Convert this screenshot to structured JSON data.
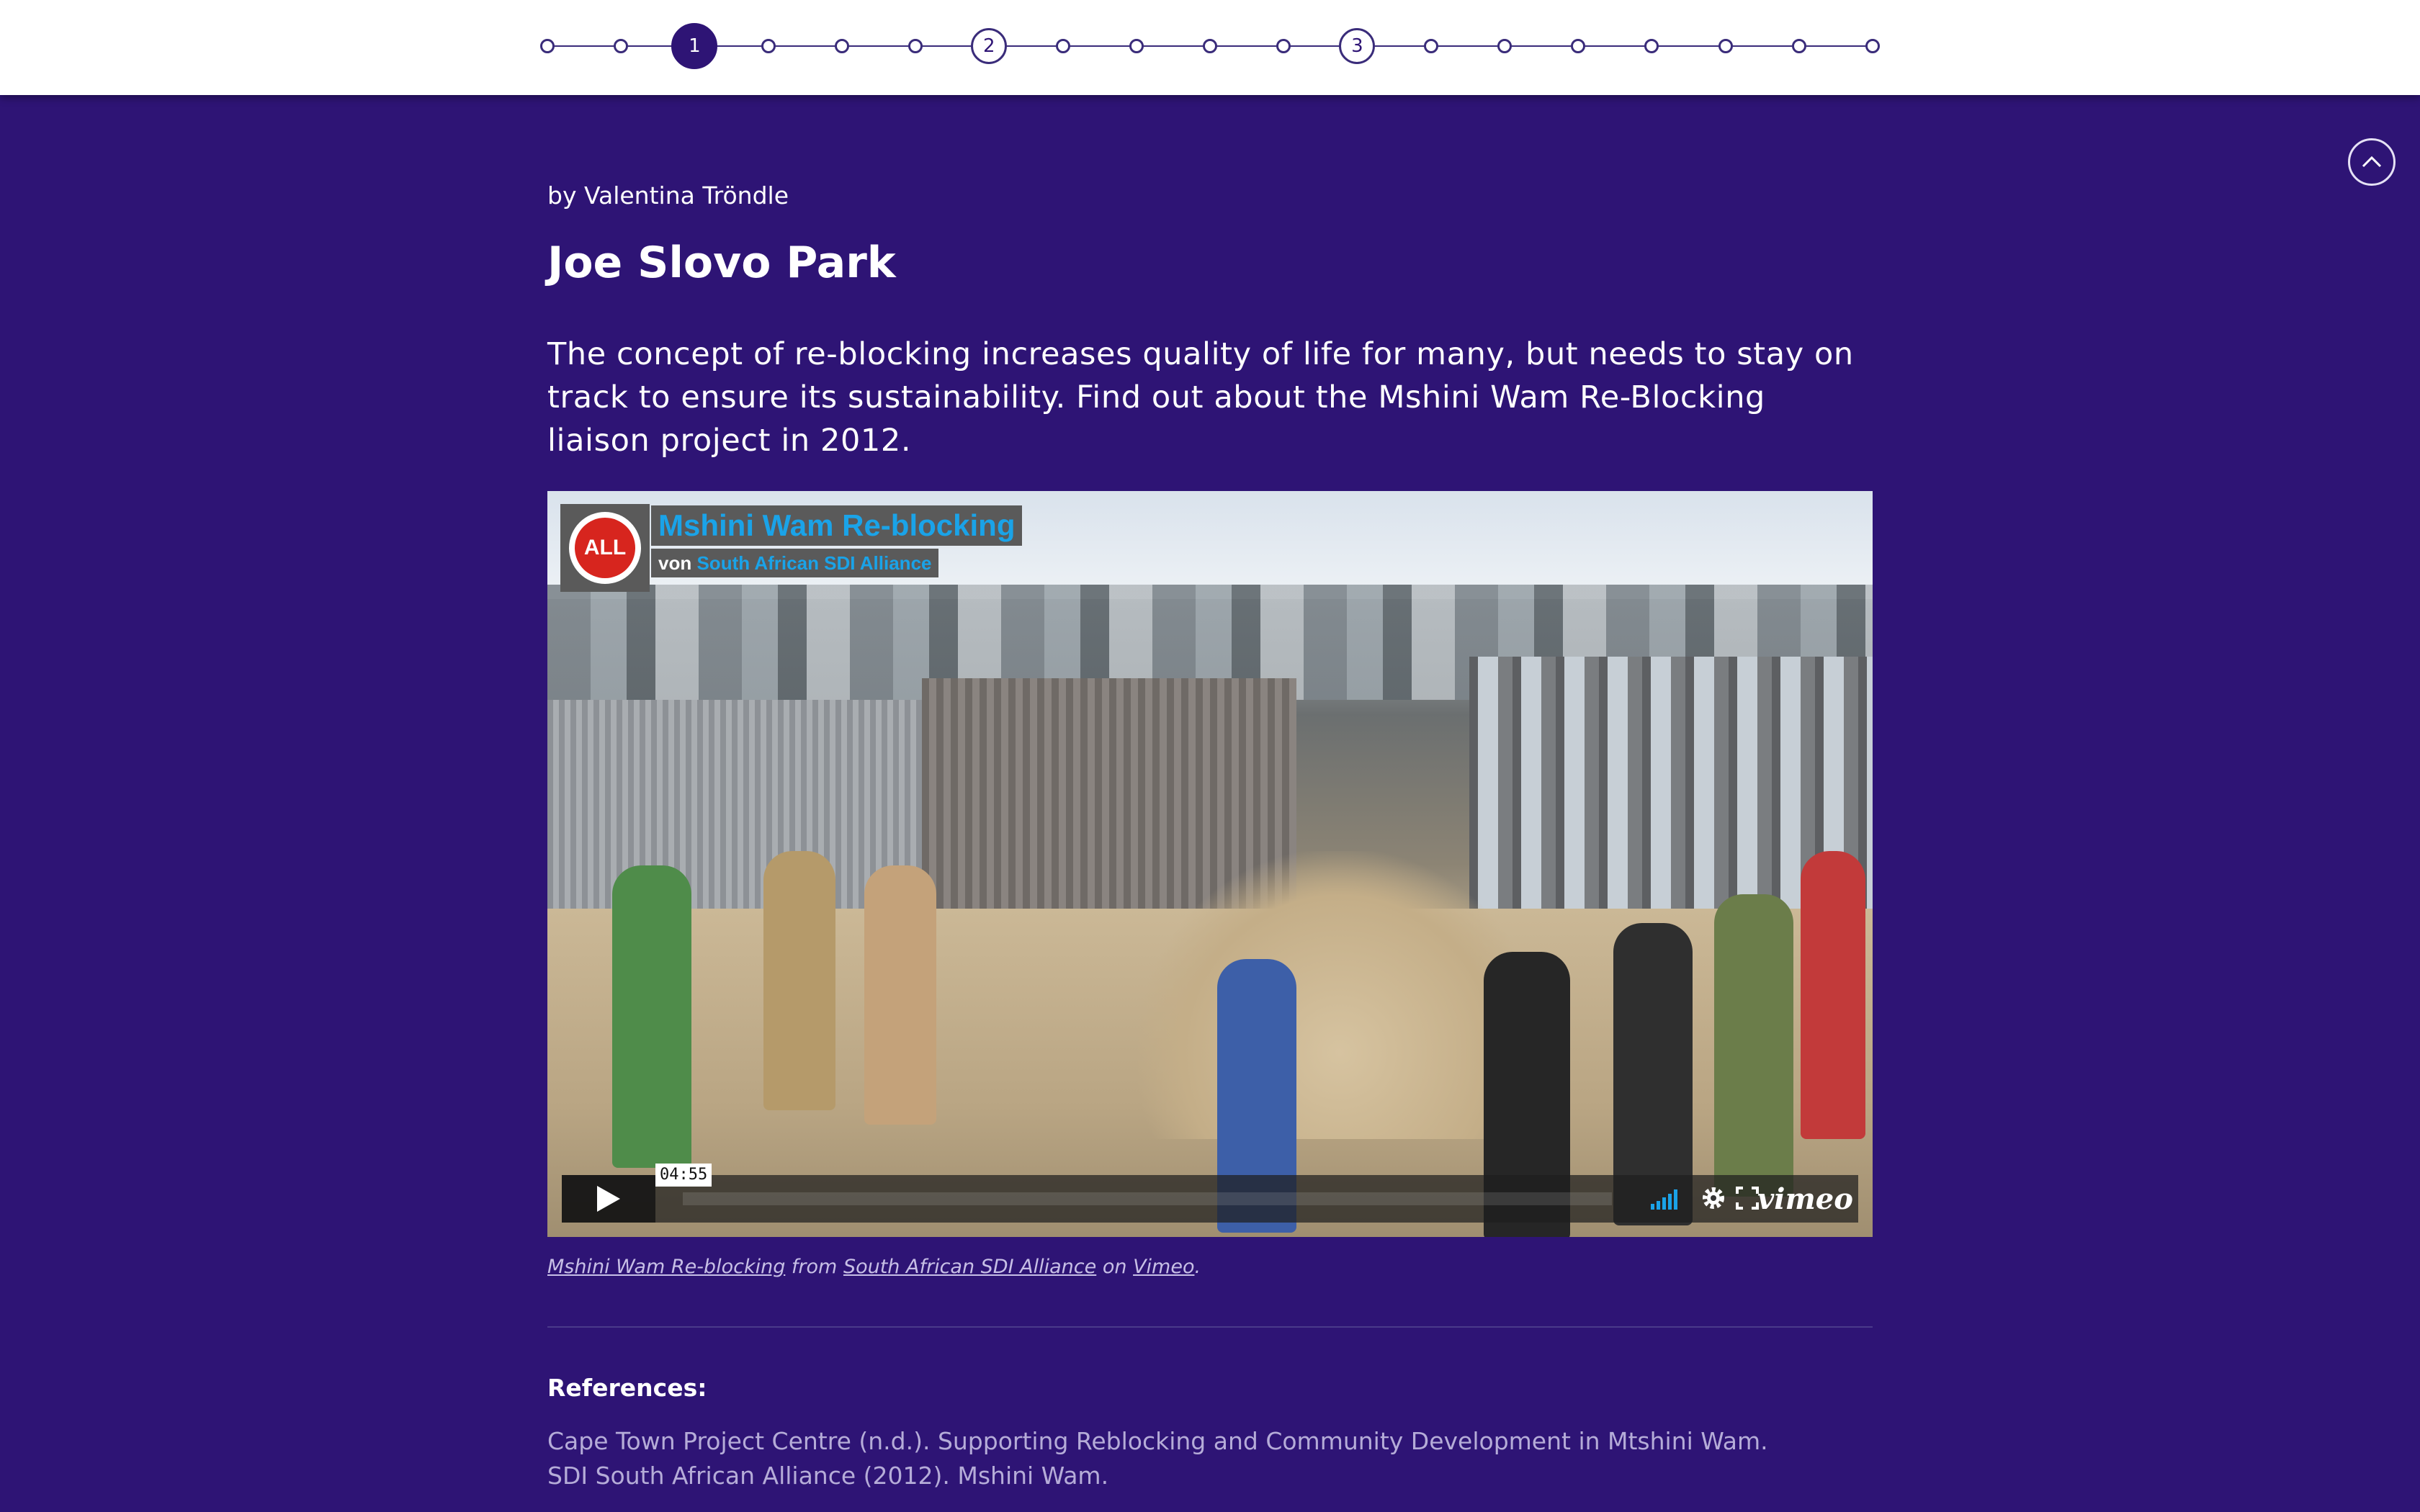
{
  "nav": {
    "steps": [
      {
        "label": ""
      },
      {
        "label": ""
      },
      {
        "label": "1"
      },
      {
        "label": ""
      },
      {
        "label": ""
      },
      {
        "label": ""
      },
      {
        "label": "2"
      },
      {
        "label": ""
      },
      {
        "label": ""
      },
      {
        "label": ""
      },
      {
        "label": ""
      },
      {
        "label": "3"
      },
      {
        "label": ""
      },
      {
        "label": ""
      },
      {
        "label": ""
      },
      {
        "label": ""
      },
      {
        "label": ""
      },
      {
        "label": ""
      },
      {
        "label": ""
      }
    ],
    "active_step": "1"
  },
  "article": {
    "byline": "by Valentina Tröndle",
    "title": "Joe Slovo Park",
    "lede": "The concept of re-blocking increases quality of life for many, but needs to stay on track to ensure its sustainability. Find out about the Mshini Wam Re-Blocking liaison project in 2012."
  },
  "video": {
    "title": "Mshini Wam Re-blocking",
    "by_prefix": "von",
    "by_channel": "South African SDI Alliance",
    "logo_text": "ALL",
    "timecode": "04:55",
    "brand": "vimeo"
  },
  "caption": {
    "video_link": "Mshini Wam Re-blocking",
    "from": "from",
    "channel_link": "South African SDI Alliance",
    "on": "on",
    "platform_link": "Vimeo",
    "end": "."
  },
  "references": {
    "heading": "References:",
    "items": [
      "Cape Town Project Centre (n.d.). Supporting Reblocking and Community Development in Mtshini Wam.",
      "SDI South African Alliance (2012). Mshini Wam."
    ]
  },
  "colors": {
    "background": "#2e1475",
    "topbar": "#ffffff",
    "accent": "#1aa3e8",
    "muted_text": "#b5acd8"
  },
  "icons": [
    "scroll-top-icon",
    "play-icon",
    "volume-icon",
    "settings-gear-icon",
    "fullscreen-icon"
  ]
}
